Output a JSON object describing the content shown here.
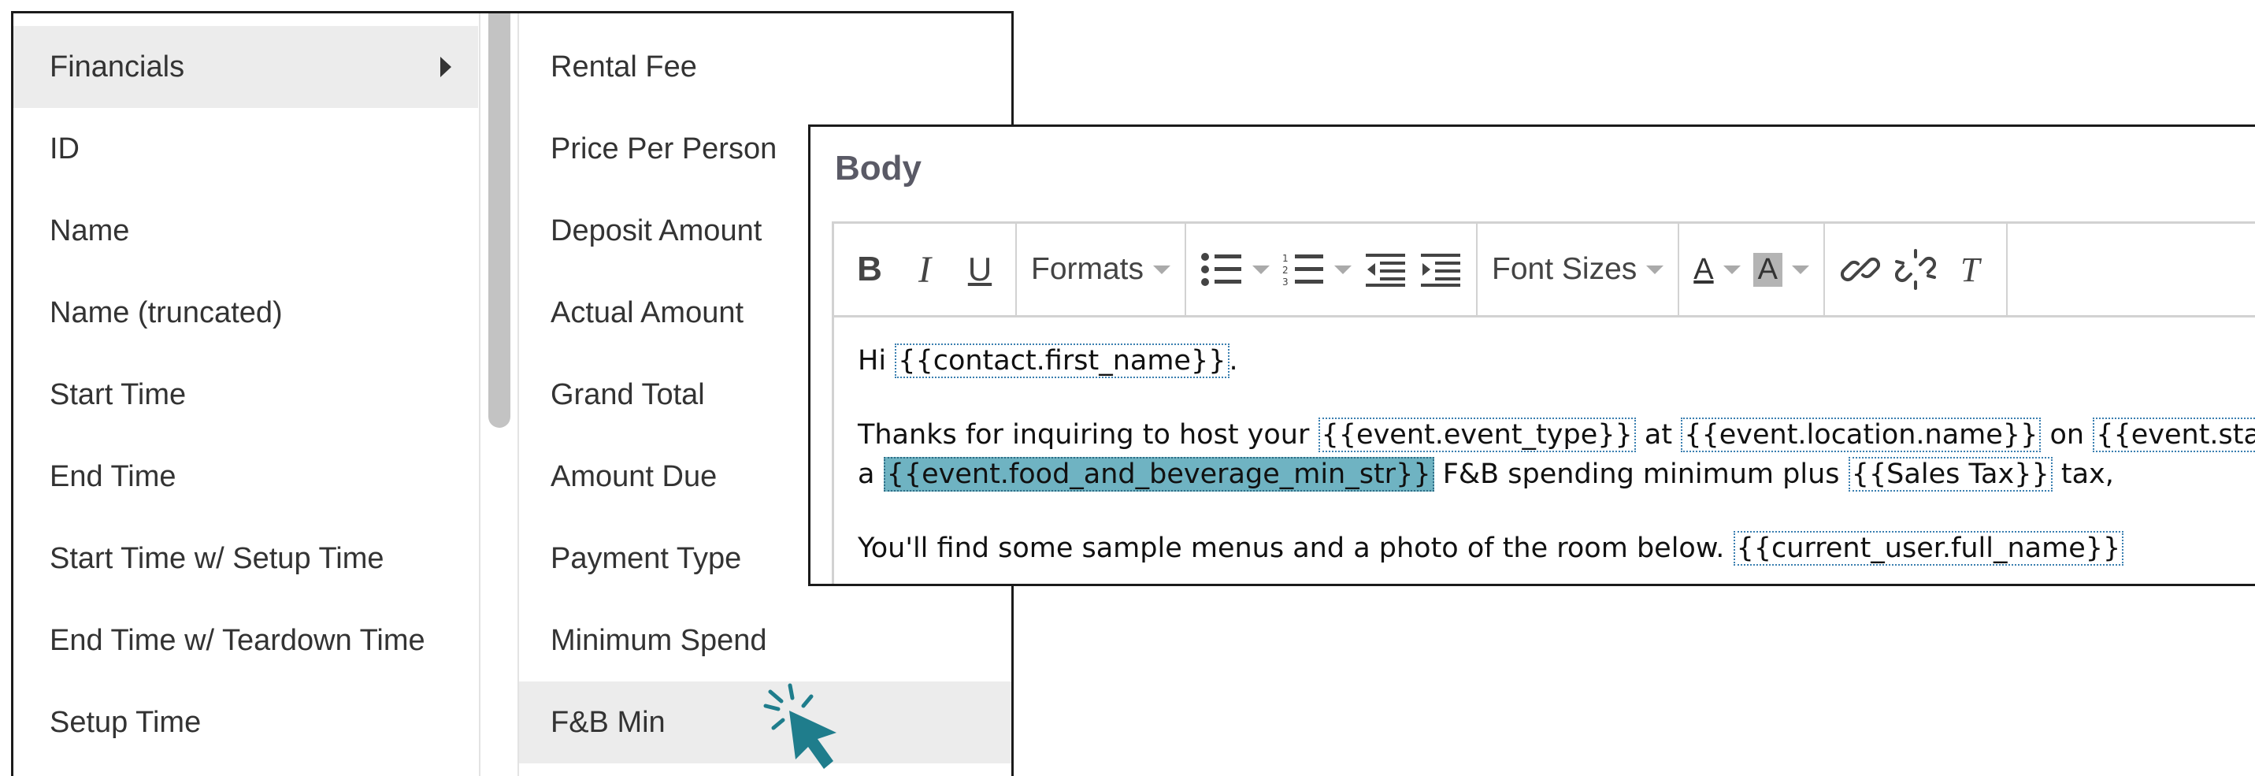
{
  "menu": {
    "left_items": [
      {
        "label": "Financials",
        "has_submenu": true,
        "active": true
      },
      {
        "label": "ID"
      },
      {
        "label": "Name"
      },
      {
        "label": "Name (truncated)"
      },
      {
        "label": "Start Time"
      },
      {
        "label": "End Time"
      },
      {
        "label": "Start Time w/ Setup Time"
      },
      {
        "label": "End Time w/ Teardown Time"
      },
      {
        "label": "Setup Time"
      }
    ],
    "right_items": [
      {
        "label": "Rental Fee"
      },
      {
        "label": "Price Per Person"
      },
      {
        "label": "Deposit Amount"
      },
      {
        "label": "Actual Amount"
      },
      {
        "label": "Grand Total"
      },
      {
        "label": "Amount Due"
      },
      {
        "label": "Payment Type"
      },
      {
        "label": "Minimum Spend"
      },
      {
        "label": "F&B Min",
        "hovered": true
      }
    ]
  },
  "editor": {
    "title": "Body",
    "toolbar": {
      "bold": "B",
      "italic": "I",
      "underline": "U",
      "formats": "Formats",
      "font_sizes": "Font Sizes",
      "font_color": "A",
      "bg_color": "A"
    },
    "body": {
      "l1_a": "Hi ",
      "l1_tag": "{{contact.first_name}}",
      "l1_b": ".",
      "l2_a": "Thanks for inquiring to host your ",
      "l2_tag1": "{{event.event_type}}",
      "l2_b": " at ",
      "l2_tag2": "{{event.location.name}}",
      "l2_c": " on ",
      "l2_tag3": "{{event.start_date}}",
      "l3_a": "a ",
      "l3_tag1": "{{event.food_and_beverage_min_str}}",
      "l3_b": "  F&B spending minimum plus ",
      "l3_tag2": "{{Sales Tax}}",
      "l3_c": " tax,",
      "l4_a": "You'll find some sample menus and a photo of the room below. ",
      "l4_tag": "{{current_user.full_name}}"
    }
  },
  "colors": {
    "selection": "#6fb3c2",
    "cursor": "#1f7d8c",
    "menu_hover": "#ececec"
  }
}
